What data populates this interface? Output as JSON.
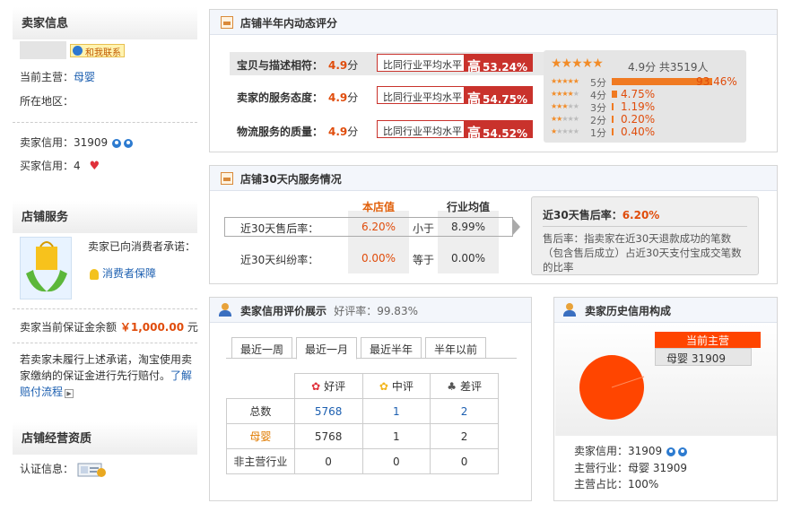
{
  "sidebar": {
    "seller_info_title": "卖家信息",
    "contact_label": "和我联系",
    "main_business_label": "当前主营：",
    "main_business_value": "母婴",
    "region_label": "所在地区：",
    "seller_credit_label": "卖家信用：",
    "seller_credit_value": "31909",
    "buyer_credit_label": "买家信用：",
    "buyer_credit_value": "4",
    "shop_service_title": "店铺服务",
    "promise_text": "卖家已向消费者承诺：",
    "consumer_protection": "消费者保障",
    "deposit_label": "卖家当前保证金余额",
    "deposit_value": "￥1,000.00",
    "deposit_unit": "元",
    "deposit_note": "若卖家未履行上述承诺，淘宝使用卖家缴纳的保证金进行先行赔付。",
    "deposit_link1": "了解",
    "deposit_link2": "赔付流程",
    "qualification_title": "店铺经营资质",
    "cert_label": "认证信息："
  },
  "half_year": {
    "title": "店铺半年内动态评分",
    "rows": [
      {
        "label": "宝贝与描述相符：",
        "score": "4.9",
        "unit": "分",
        "cmp_text": "比同行业平均水平",
        "cmp_high": "高",
        "cmp_value": "53.24%"
      },
      {
        "label": "卖家的服务态度：",
        "score": "4.9",
        "unit": "分",
        "cmp_text": "比同行业平均水平",
        "cmp_high": "高",
        "cmp_value": "54.75%"
      },
      {
        "label": "物流服务的质量：",
        "score": "4.9",
        "unit": "分",
        "cmp_text": "比同行业平均水平",
        "cmp_high": "高",
        "cmp_value": "54.52%"
      }
    ],
    "summary": {
      "score": "4.9分",
      "total": "共3519人",
      "rating": 4.9
    },
    "dist": [
      {
        "label": "5分",
        "pct": "93.46%",
        "fraction": 0.9346
      },
      {
        "label": "4分",
        "pct": "4.75%",
        "fraction": 0.0475
      },
      {
        "label": "3分",
        "pct": "1.19%",
        "fraction": 0.0119
      },
      {
        "label": "2分",
        "pct": "0.20%",
        "fraction": 0.002
      },
      {
        "label": "1分",
        "pct": "0.40%",
        "fraction": 0.004
      }
    ]
  },
  "days30": {
    "title": "店铺30天内服务情况",
    "col_store": "本店值",
    "col_industry": "行业均值",
    "rows": [
      {
        "label": "近30天售后率：",
        "store": "6.20%",
        "cmp": "小于",
        "industry": "8.99%"
      },
      {
        "label": "近30天纠纷率：",
        "store": "0.00%",
        "cmp": "等于",
        "industry": "0.00%"
      }
    ],
    "tip_title": "近30天售后率：",
    "tip_value": "6.20%",
    "tip_text": "售后率：指卖家在近30天退款成功的笔数（包含售后成立）占近30天支付宝成交笔数的比率"
  },
  "credit": {
    "title": "卖家信用评价展示",
    "good_rate_label": "好评率：",
    "good_rate_value": "99.83%",
    "tabs": [
      "最近一周",
      "最近一月",
      "最近半年",
      "半年以前"
    ],
    "active_tab": 1,
    "headers": [
      "好评",
      "中评",
      "差评"
    ],
    "rows": [
      {
        "label": "总数",
        "good": "5768",
        "mid": "1",
        "bad": "2"
      },
      {
        "label": "母婴",
        "good": "5768",
        "mid": "1",
        "bad": "2"
      },
      {
        "label": "非主营行业",
        "good": "0",
        "mid": "0",
        "bad": "0"
      }
    ]
  },
  "history": {
    "title": "卖家历史信用构成",
    "legend_title": "当前主营",
    "legend_item": "母婴",
    "legend_value": "31909",
    "pie_color": "#ff4500",
    "seller_credit_label": "卖家信用：",
    "seller_credit_value": "31909",
    "main_industry_label": "主营行业：",
    "main_industry_value": "母婴 31909",
    "main_share_label": "主营占比：",
    "main_share_value": "100%"
  },
  "colors": {
    "accent": "#e04c0b",
    "compare_red": "#c9322c",
    "link": "#1c5fb0"
  }
}
